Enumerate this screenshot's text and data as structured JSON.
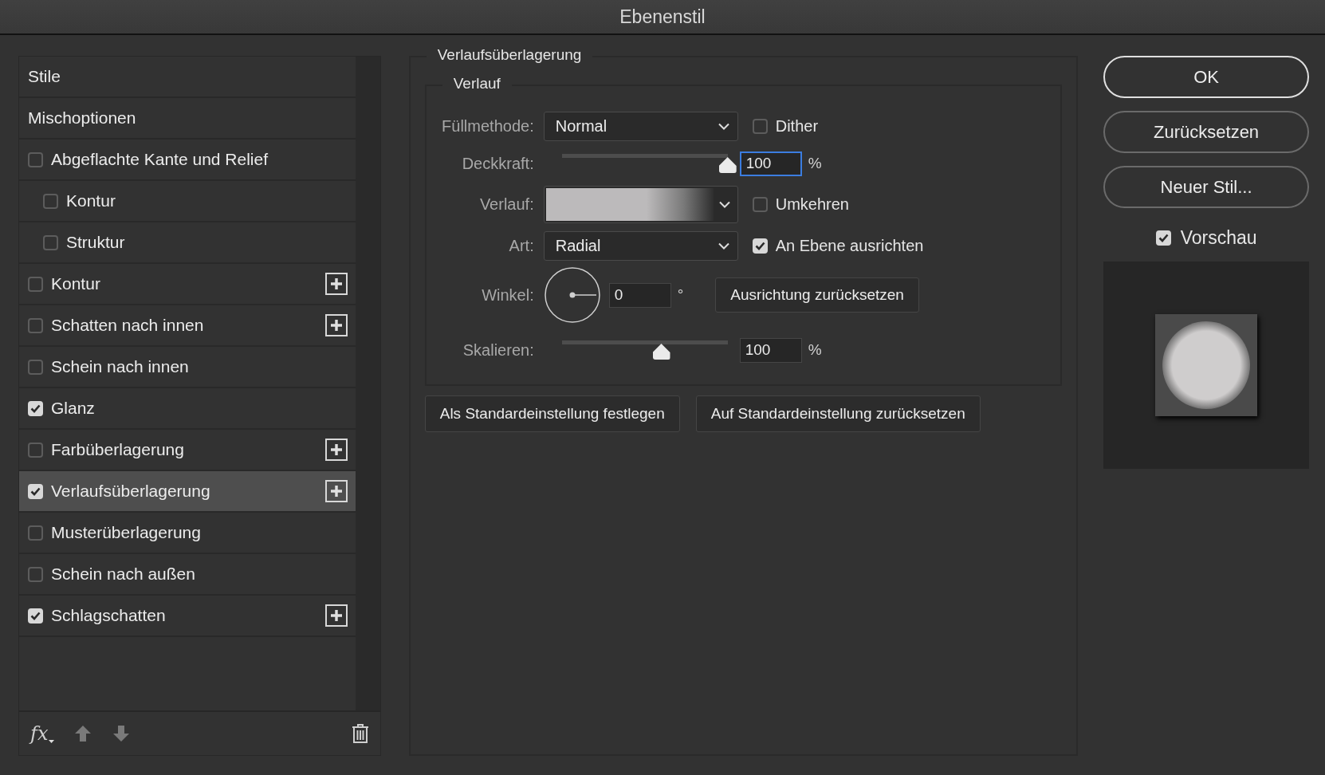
{
  "window": {
    "title": "Ebenenstil"
  },
  "styles_list": [
    {
      "kind": "header",
      "label": "Stile",
      "selected": false
    },
    {
      "kind": "header",
      "label": "Mischoptionen",
      "selected": false
    },
    {
      "kind": "effect",
      "label": "Abgeflachte Kante und Relief",
      "checked": false,
      "selected": false,
      "addable": false,
      "children": [
        {
          "kind": "effect",
          "label": "Kontur",
          "checked": false,
          "selected": false,
          "addable": false
        },
        {
          "kind": "effect",
          "label": "Struktur",
          "checked": false,
          "selected": false,
          "addable": false
        }
      ]
    },
    {
      "kind": "effect",
      "label": "Kontur",
      "checked": false,
      "selected": false,
      "addable": true
    },
    {
      "kind": "effect",
      "label": "Schatten nach innen",
      "checked": false,
      "selected": false,
      "addable": true
    },
    {
      "kind": "effect",
      "label": "Schein nach innen",
      "checked": false,
      "selected": false,
      "addable": false
    },
    {
      "kind": "effect",
      "label": "Glanz",
      "checked": true,
      "selected": false,
      "addable": false
    },
    {
      "kind": "effect",
      "label": "Farbüberlagerung",
      "checked": false,
      "selected": false,
      "addable": true
    },
    {
      "kind": "effect",
      "label": "Verlaufsüberlagerung",
      "checked": true,
      "selected": true,
      "addable": true
    },
    {
      "kind": "effect",
      "label": "Musterüberlagerung",
      "checked": false,
      "selected": false,
      "addable": false
    },
    {
      "kind": "effect",
      "label": "Schein nach außen",
      "checked": false,
      "selected": false,
      "addable": false
    },
    {
      "kind": "effect",
      "label": "Schlagschatten",
      "checked": true,
      "selected": false,
      "addable": true
    }
  ],
  "list_toolbar": {
    "fx_label": "fx"
  },
  "settings": {
    "title": "Verlaufsüberlagerung",
    "group_title": "Verlauf",
    "rows": [
      {
        "kind": "dropdown",
        "label": "Füllmethode:",
        "value": "Normal",
        "option": {
          "label": "Dither",
          "checked": false
        }
      },
      {
        "kind": "slider",
        "label": "Deckkraft:",
        "level": 1.0,
        "value": "100",
        "unit": "%",
        "focused": true
      },
      {
        "kind": "gradient",
        "label": "Verlauf:",
        "option": {
          "label": "Umkehren",
          "checked": false
        }
      },
      {
        "kind": "dropdown",
        "label": "Art:",
        "value": "Radial",
        "option": {
          "label": "An Ebene ausrichten",
          "checked": true
        }
      },
      {
        "kind": "angle",
        "label": "Winkel:",
        "value": "0",
        "unit": "°",
        "button": "Ausrichtung zurücksetzen"
      },
      {
        "kind": "slider",
        "label": "Skalieren:",
        "level": 0.6,
        "value": "100",
        "unit": "%",
        "focused": false
      }
    ],
    "buttons": [
      "Als Standardeinstellung festlegen",
      "Auf Standardeinstellung zurücksetzen"
    ]
  },
  "actions": [
    {
      "label": "OK",
      "default": true
    },
    {
      "label": "Zurücksetzen",
      "default": false
    },
    {
      "label": "Neuer Stil...",
      "default": false
    }
  ],
  "preview": {
    "label": "Vorschau",
    "checked": true
  }
}
